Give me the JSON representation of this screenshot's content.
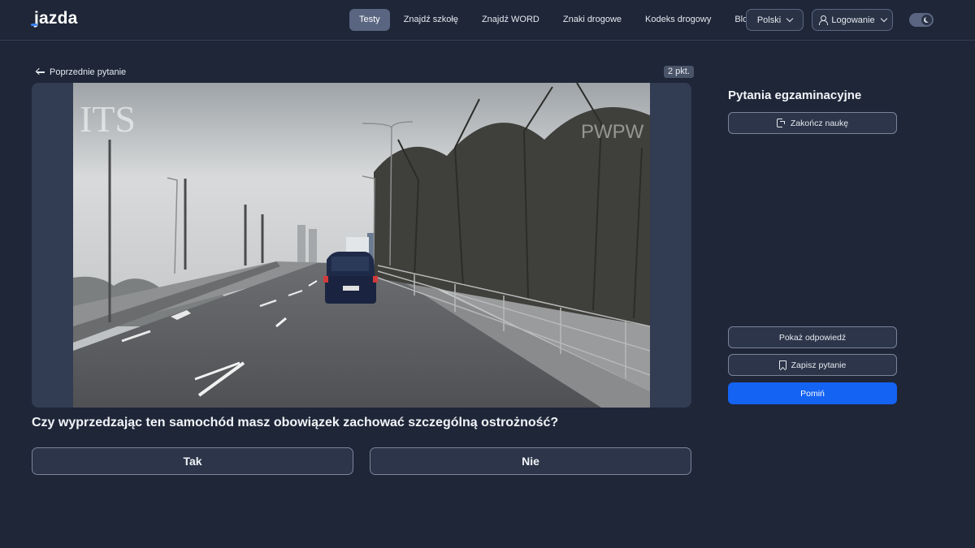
{
  "header": {
    "logo": "jazda",
    "nav": [
      {
        "label": "Testy",
        "active": true
      },
      {
        "label": "Znajdź szkołę",
        "active": false
      },
      {
        "label": "Znajdź WORD",
        "active": false
      },
      {
        "label": "Znaki drogowe",
        "active": false
      },
      {
        "label": "Kodeks drogowy",
        "active": false
      },
      {
        "label": "Blog",
        "active": false
      }
    ],
    "language_label": "Polski",
    "login_label": "Logowanie",
    "theme_toggle_icon": "moon-icon"
  },
  "question": {
    "back_label": "Poprzednie pytanie",
    "points": "2 pkt.",
    "text": "Czy wyprzedzając ten samochód masz obowiązek zachować szczególną ostrożność?",
    "answers": [
      "Tak",
      "Nie"
    ],
    "media_watermarks": [
      "ITS",
      "PWPW"
    ]
  },
  "sidebar": {
    "title": "Pytania egzaminacyjne",
    "finish_label": "Zakończ naukę",
    "show_answer_label": "Pokaż odpowiedź",
    "save_label": "Zapisz pytanie",
    "skip_label": "Pomiń"
  },
  "colors": {
    "background": "#1e2638",
    "accent": "#1463f3",
    "active_nav": "#5a6681"
  }
}
